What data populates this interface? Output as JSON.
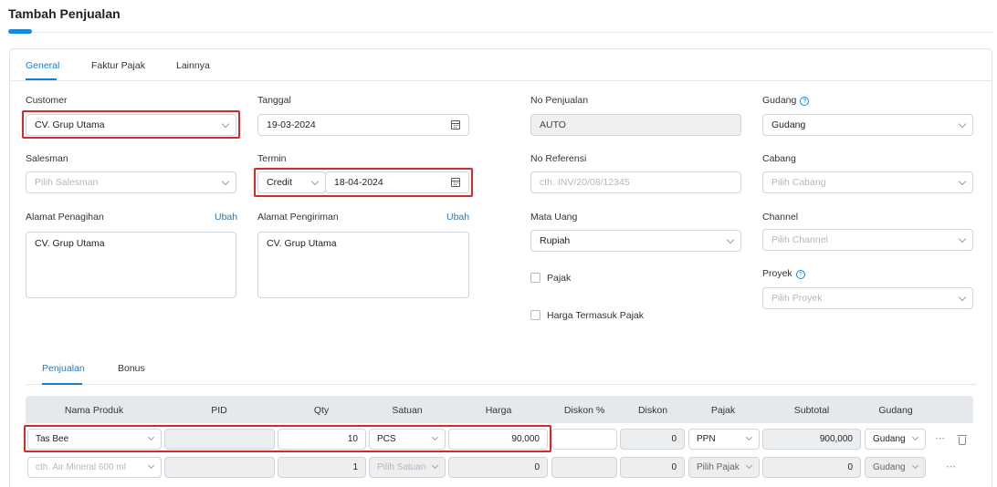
{
  "page": {
    "title": "Tambah Penjualan"
  },
  "tabs": [
    "General",
    "Faktur Pajak",
    "Lainnya"
  ],
  "form": {
    "customer": {
      "label": "Customer",
      "value": "CV. Grup Utama"
    },
    "tanggal": {
      "label": "Tanggal",
      "value": "19-03-2024"
    },
    "no_penjualan": {
      "label": "No Penjualan",
      "value": "AUTO"
    },
    "gudang": {
      "label": "Gudang",
      "value": "Gudang"
    },
    "salesman": {
      "label": "Salesman",
      "placeholder": "Pilih Salesman"
    },
    "termin": {
      "label": "Termin",
      "type": "Credit",
      "date": "18-04-2024"
    },
    "no_referensi": {
      "label": "No Referensi",
      "placeholder": "cth. INV/20/08/12345"
    },
    "cabang": {
      "label": "Cabang",
      "placeholder": "Pilih Cabang"
    },
    "alamat_penagihan": {
      "label": "Alamat Penagihan",
      "link": "Ubah",
      "value": "CV. Grup Utama"
    },
    "alamat_pengiriman": {
      "label": "Alamat Pengiriman",
      "link": "Ubah",
      "value": "CV. Grup Utama"
    },
    "mata_uang": {
      "label": "Mata Uang",
      "value": "Rupiah"
    },
    "channel": {
      "label": "Channel",
      "placeholder": "Pilih Channel"
    },
    "pajak": {
      "label": "Pajak",
      "checked": false
    },
    "proyek": {
      "label": "Proyek",
      "placeholder": "Pilih Proyek"
    },
    "harga_termasuk_pajak": {
      "label": "Harga Termasuk Pajak",
      "checked": false
    }
  },
  "sub_tabs": [
    "Penjualan",
    "Bonus"
  ],
  "table": {
    "headers": [
      "Nama Produk",
      "PID",
      "Qty",
      "Satuan",
      "Harga",
      "Diskon %",
      "Diskon",
      "Pajak",
      "Subtotal",
      "Gudang"
    ],
    "rows": [
      {
        "produk": "Tas Bee",
        "pid": "",
        "qty": "10",
        "satuan": "PCS",
        "harga": "90,000",
        "diskon_pct": "",
        "diskon": "0",
        "pajak": "PPN",
        "subtotal": "900,000",
        "gudang": "Gudang"
      },
      {
        "produk_placeholder": "cth. Air Mineral 600 ml",
        "pid": "",
        "qty": "1",
        "satuan_placeholder": "Pilih Satuan",
        "harga": "0",
        "diskon_pct": "",
        "diskon": "0",
        "pajak_placeholder": "Pilih Pajak",
        "subtotal": "0",
        "gudang": "Gudang"
      }
    ]
  },
  "icons": {
    "more": "⋯",
    "help": "?"
  },
  "colors": {
    "accent": "#1a7bc6",
    "highlight": "#d42a2a"
  }
}
